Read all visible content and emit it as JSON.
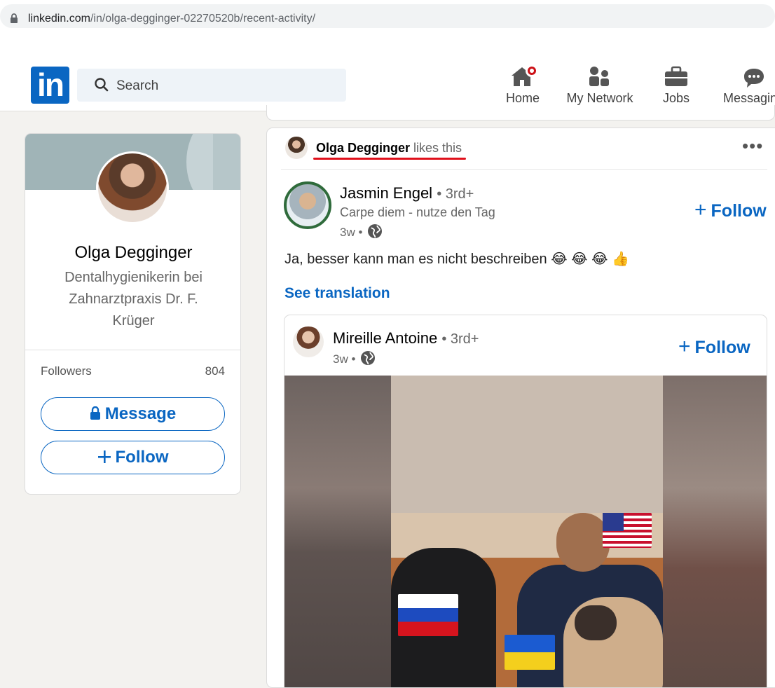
{
  "browser": {
    "url_host": "linkedin.com",
    "url_path": "/in/olga-degginger-02270520b/recent-activity/"
  },
  "header": {
    "logo_text": "in",
    "search_placeholder": "Search",
    "nav": {
      "home": "Home",
      "network": "My Network",
      "jobs": "Jobs",
      "messaging": "Messaging"
    }
  },
  "profile": {
    "name": "Olga Degginger",
    "headline": "Dentalhygienikerin bei Zahnarztpraxis Dr. F. Krüger",
    "followers_label": "Followers",
    "followers_count": "804",
    "message_label": "Message",
    "follow_label": "Follow"
  },
  "feed": {
    "activity": {
      "liker_name": "Olga Degginger",
      "action": "likes this"
    },
    "post": {
      "author_name": "Jasmin Engel",
      "degree": "• 3rd+",
      "headline": "Carpe diem - nutze den Tag",
      "time": "3w •",
      "follow_label": "Follow",
      "text": "Ja, besser kann man es nicht beschreiben 😂 😂 😂 👍",
      "see_translation": "See translation"
    },
    "reshare": {
      "author_name": "Mireille Antoine",
      "degree": "• 3rd+",
      "time": "3w •",
      "follow_label": "Follow"
    }
  },
  "colors": {
    "linkedin_blue": "#0a66c2",
    "highlight_red": "#e0101b",
    "notification_red": "#cc1016"
  }
}
